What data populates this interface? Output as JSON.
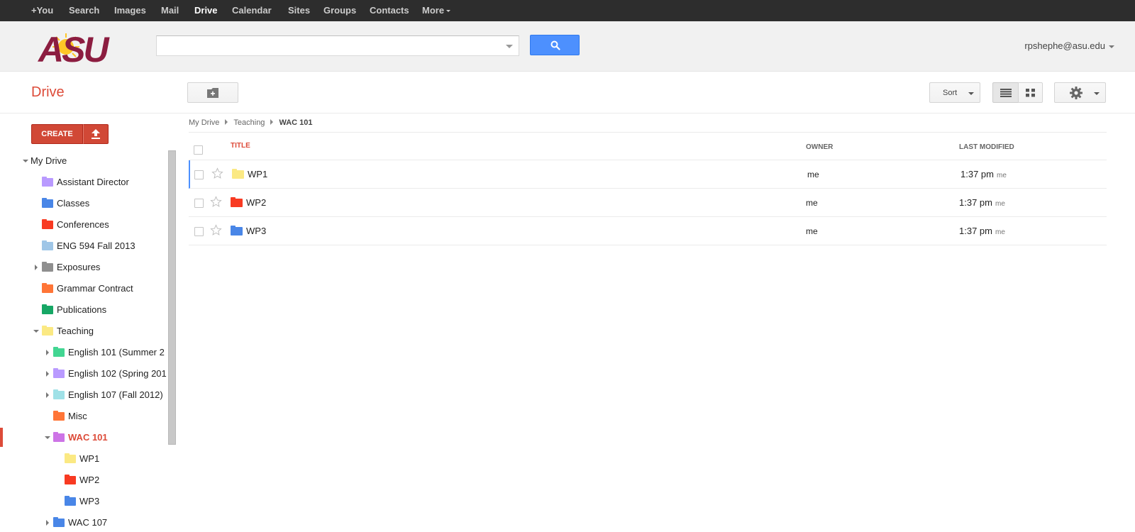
{
  "topbar": {
    "items": [
      {
        "label": "+You",
        "active": false
      },
      {
        "label": "Search",
        "active": false
      },
      {
        "label": "Images",
        "active": false
      },
      {
        "label": "Mail",
        "active": false
      },
      {
        "label": "Drive",
        "active": true
      },
      {
        "label": "Calendar",
        "active": false
      },
      {
        "label": "Sites",
        "active": false
      },
      {
        "label": "Groups",
        "active": false
      },
      {
        "label": "Contacts",
        "active": false
      },
      {
        "label": "More",
        "active": false
      }
    ]
  },
  "header": {
    "logo_text": "ASU",
    "search_value": "",
    "account": "rpshephe@asu.edu"
  },
  "toolbar": {
    "app_title": "Drive",
    "sort_label": "Sort"
  },
  "sidebar": {
    "create_label": "CREATE",
    "tree": [
      {
        "label": "My Drive",
        "color": null,
        "expander": "down"
      },
      {
        "label": "Assistant Director",
        "color": "#b99aff",
        "expander": null
      },
      {
        "label": "Classes",
        "color": "#4986e7",
        "expander": null
      },
      {
        "label": "Conferences",
        "color": "#f83a22",
        "expander": null
      },
      {
        "label": "ENG 594 Fall 2013",
        "color": "#9fc6e7",
        "expander": null,
        "shared": true
      },
      {
        "label": "Exposures",
        "color": "#8f8f8f",
        "expander": "right"
      },
      {
        "label": "Grammar Contract",
        "color": "#ff7537",
        "expander": null
      },
      {
        "label": "Publications",
        "color": "#16a765",
        "expander": null
      },
      {
        "label": "Teaching",
        "color": "#fbe983",
        "expander": "down"
      },
      {
        "label": "English 101 (Summer 2",
        "color": "#42d692",
        "expander": "right"
      },
      {
        "label": "English 102 (Spring 201",
        "color": "#b99aff",
        "expander": "right"
      },
      {
        "label": "English 107 (Fall 2012)",
        "color": "#9fe1e7",
        "expander": "right"
      },
      {
        "label": "Misc",
        "color": "#ff7537",
        "expander": null
      },
      {
        "label": "WAC 101",
        "color": "#cd74e6",
        "expander": "down",
        "selected": true
      },
      {
        "label": "WP1",
        "color": "#fbe983",
        "expander": null
      },
      {
        "label": "WP2",
        "color": "#f83a22",
        "expander": null
      },
      {
        "label": "WP3",
        "color": "#4986e7",
        "expander": null
      },
      {
        "label": "WAC 107",
        "color": "#4986e7",
        "expander": "right"
      }
    ]
  },
  "main": {
    "breadcrumb": [
      "My Drive",
      "Teaching",
      "WAC 101"
    ],
    "columns": {
      "title": "TITLE",
      "owner": "OWNER",
      "modified": "LAST MODIFIED"
    },
    "rows": [
      {
        "name": "WP1",
        "color": "#fbe983",
        "owner": "me",
        "modified": "1:37 pm",
        "modified_by": "me"
      },
      {
        "name": "WP2",
        "color": "#f83a22",
        "owner": "me",
        "modified": "1:37 pm",
        "modified_by": "me"
      },
      {
        "name": "WP3",
        "color": "#4986e7",
        "owner": "me",
        "modified": "1:37 pm",
        "modified_by": "me"
      }
    ]
  }
}
